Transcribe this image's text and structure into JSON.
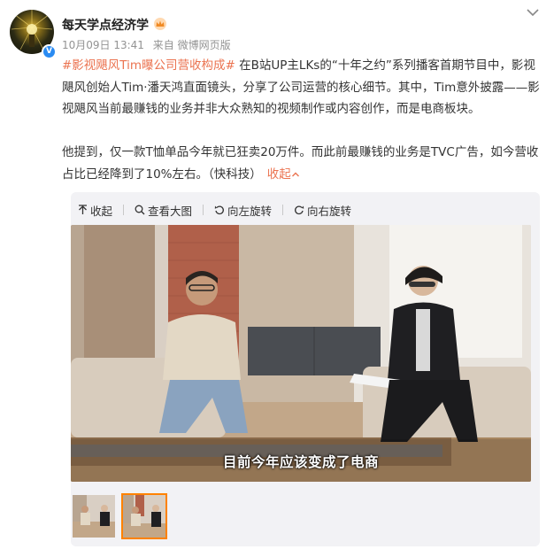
{
  "post": {
    "username": "每天学点经济学",
    "date": "10月09日 13:41",
    "source": "来自 微博网页版",
    "topic": "#影视飓风Tim曝公司营收构成#",
    "para1": " 在B站UP主LKs的“十年之约”系列播客首期节目中，影视飓风创始人Tim·潘天鸿直面镜头，分享了公司运营的核心细节。其中，Tim意外披露——影视飓风当前最赚钱的业务并非大众熟知的视频制作或内容创作，而是电商板块。",
    "para2": "他提到，仅一款T恤单品今年就已狂卖20万件。而此前最赚钱的业务是TVC广告，如今营收占比已经降到了10%左右。（快科技）",
    "collapse_label": "收起"
  },
  "toolbar": {
    "collapse": "收起",
    "view_large": "查看大图",
    "rotate_left": "向左旋转",
    "rotate_right": "向右旋转"
  },
  "image": {
    "subtitle": "目前今年应该变成了电商",
    "thumbnails": 2,
    "selected_index": 2
  },
  "icons": [
    "verified-icon",
    "crown-badge-icon",
    "chevron-down-icon",
    "collapse-arrow-icon",
    "zoom-icon",
    "rotate-left-icon",
    "rotate-right-icon"
  ],
  "colors": {
    "accent": "#eb7350",
    "selected_border": "#ff8200",
    "verified": "#2a8bf2"
  }
}
